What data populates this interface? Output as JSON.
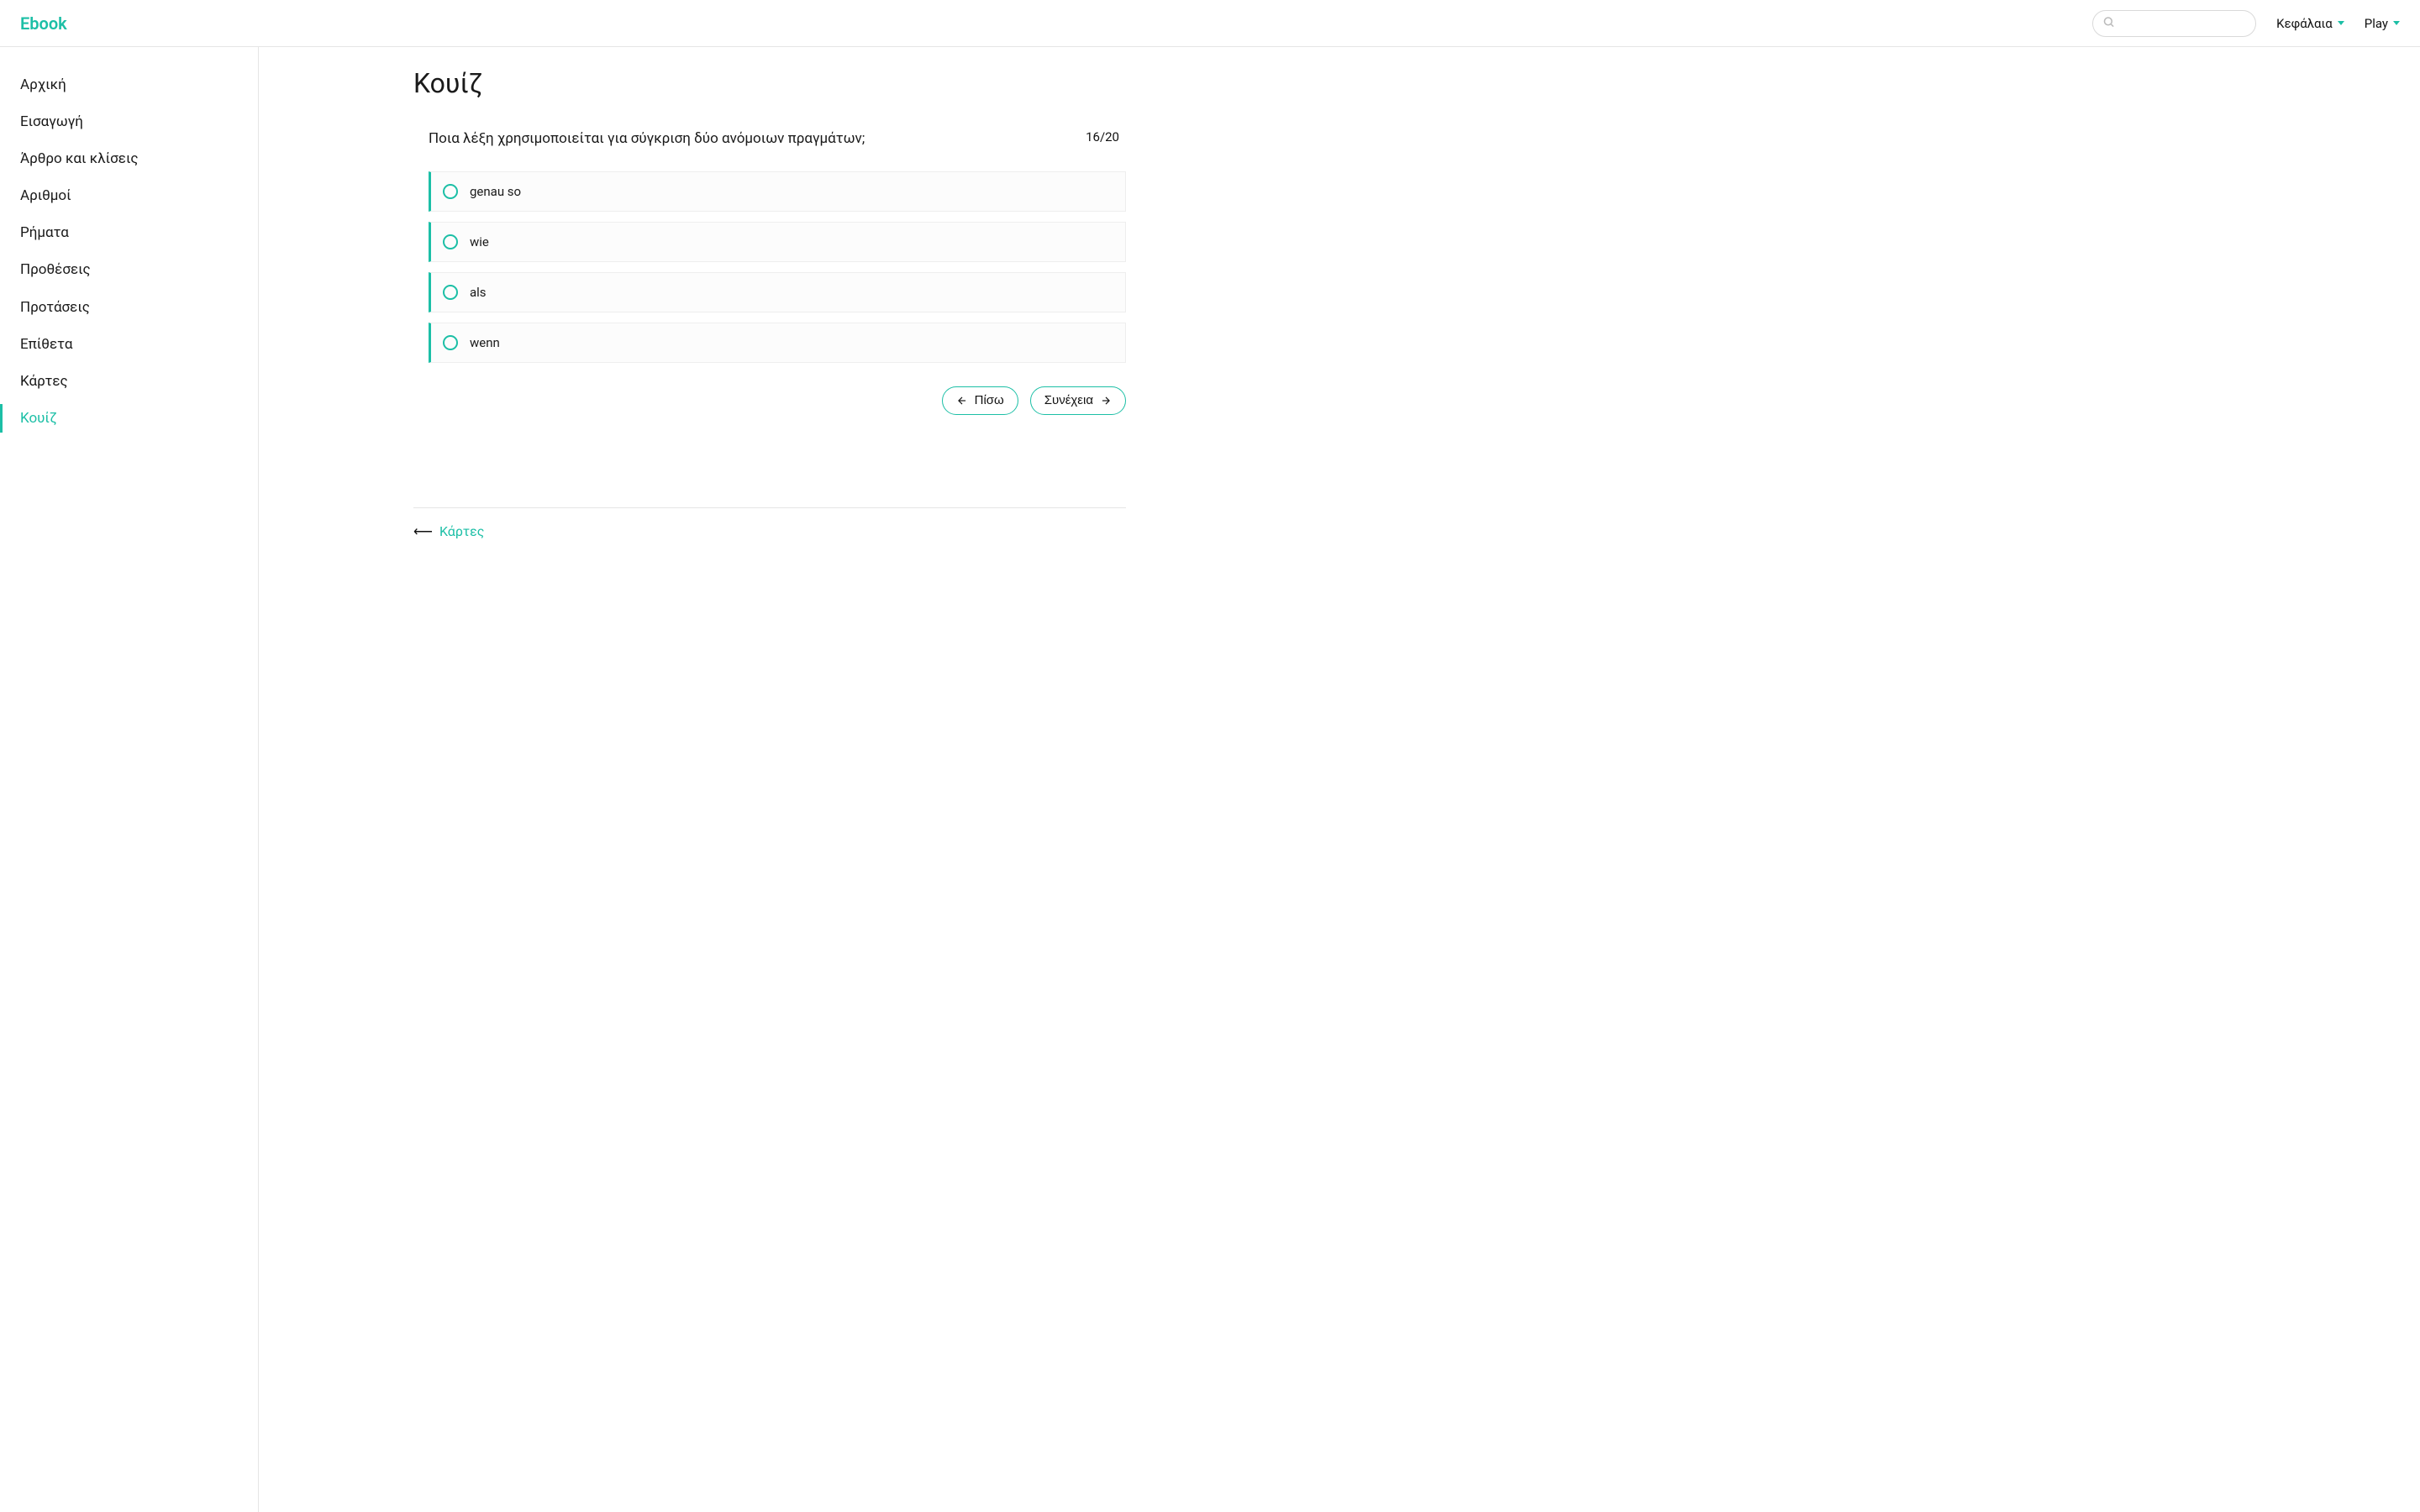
{
  "header": {
    "brand": "Ebook",
    "nav": {
      "chapters_label": "Κεφάλαια",
      "play_label": "Play"
    },
    "search_placeholder": ""
  },
  "sidebar": {
    "items": [
      {
        "label": "Αρχική",
        "active": false
      },
      {
        "label": "Εισαγωγή",
        "active": false
      },
      {
        "label": "Άρθρο και κλίσεις",
        "active": false
      },
      {
        "label": "Αριθμοί",
        "active": false
      },
      {
        "label": "Ρήματα",
        "active": false
      },
      {
        "label": "Προθέσεις",
        "active": false
      },
      {
        "label": "Προτάσεις",
        "active": false
      },
      {
        "label": "Επίθετα",
        "active": false
      },
      {
        "label": "Κάρτες",
        "active": false
      },
      {
        "label": "Κουίζ",
        "active": true
      }
    ]
  },
  "page": {
    "title": "Κουίζ"
  },
  "quiz": {
    "question": "Ποια λέξη χρησιμοποιείται για σύγκριση δύο ανόμοιων πραγμάτων;",
    "progress": "16/20",
    "options": [
      "genau so",
      "wie",
      "als",
      "wenn"
    ],
    "back_label": "Πίσω",
    "next_label": "Συνέχεια"
  },
  "footer": {
    "prev_chapter": "Κάρτες"
  }
}
